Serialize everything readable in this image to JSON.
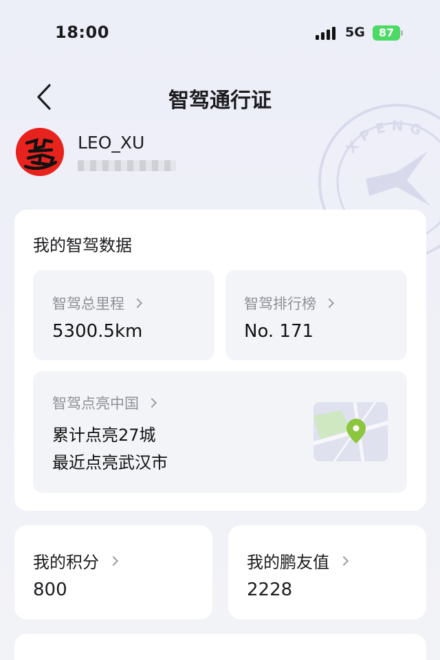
{
  "status": {
    "time": "18:00",
    "network": "5G",
    "battery": "87"
  },
  "header": {
    "title": "智驾通行证"
  },
  "user": {
    "name": "LEO_XU"
  },
  "driving_data": {
    "section_title": "我的智驾数据",
    "mileage": {
      "label": "智驾总里程",
      "value": "5300.5km"
    },
    "ranking": {
      "label": "智驾排行榜",
      "value": "No. 171"
    },
    "china": {
      "label": "智驾点亮中国",
      "line1": "累计点亮27城",
      "line2": "最近点亮武汉市"
    }
  },
  "points": {
    "label": "我的积分",
    "value": "800"
  },
  "friends": {
    "label": "我的鹏友值",
    "value": "2228"
  },
  "stamp_text": "XPENG",
  "colors": {
    "avatar_red": "#e8231e",
    "battery_green": "#4cd964",
    "map_pin_green": "#8cc63f"
  }
}
